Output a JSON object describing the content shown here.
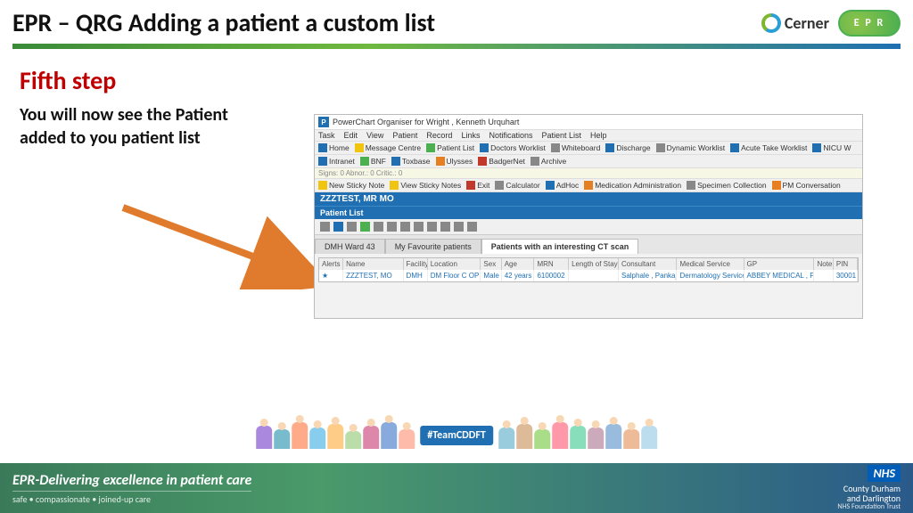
{
  "header": {
    "title": "EPR – QRG Adding a patient a custom list",
    "cerner_label": "Cerner",
    "epr_label": "E P R"
  },
  "step": {
    "title": "Fifth step",
    "body": "You will now see the Patient added to you patient list"
  },
  "screenshot": {
    "window_title": "PowerChart Organiser for Wright , Kenneth Urquhart",
    "menu": [
      "Task",
      "Edit",
      "View",
      "Patient",
      "Record",
      "Links",
      "Notifications",
      "Patient List",
      "Help"
    ],
    "toolbar1": [
      "Home",
      "Message Centre",
      "Patient List",
      "Doctors Worklist",
      "Whiteboard",
      "Discharge",
      "Dynamic Worklist",
      "Acute Take Worklist",
      "NICU W"
    ],
    "toolbar2": [
      "Intranet",
      "BNF",
      "Toxbase",
      "Ulysses",
      "BadgerNet",
      "Archive"
    ],
    "status_line": "Signs: 0  Abnor.: 0  Critic.: 0",
    "toolbar3": [
      "New Sticky Note",
      "View Sticky Notes",
      "Exit",
      "Calculator",
      "AdHoc",
      "Medication Administration",
      "Specimen Collection",
      "PM Conversation"
    ],
    "patient_name": "ZZZTEST, MR MO",
    "tab_title": "Patient List",
    "tabs": [
      "DMH Ward 43",
      "My Favourite patients",
      "Patients with an interesting CT scan"
    ],
    "columns": [
      "Alerts",
      "Name",
      "Facility",
      "Location",
      "Sex",
      "Age",
      "MRN",
      "Length of Stay",
      "Consultant",
      "Medical Service",
      "GP",
      "Note",
      "PIN"
    ],
    "row": {
      "alerts": "★",
      "name": "ZZZTEST, MO",
      "facility": "DMH",
      "location": "DM Floor C OP",
      "sex": "Male",
      "age": "42 years",
      "mrn": "6100002",
      "los": "",
      "consultant": "Salphale , Pankaj",
      "service": "Dermatology Service",
      "gp": "ABBEY MEDICAL , PRACTICE",
      "note": "",
      "pin": "30001"
    }
  },
  "people_strip": {
    "badge": "#TeamCDDFT"
  },
  "footer": {
    "title": "EPR-Delivering excellence in patient care",
    "subtitle": "safe • compassionate • joined-up care",
    "nhs": "NHS",
    "trust_line1": "County Durham",
    "trust_line2": "and Darlington",
    "trust_line3": "NHS Foundation Trust"
  }
}
